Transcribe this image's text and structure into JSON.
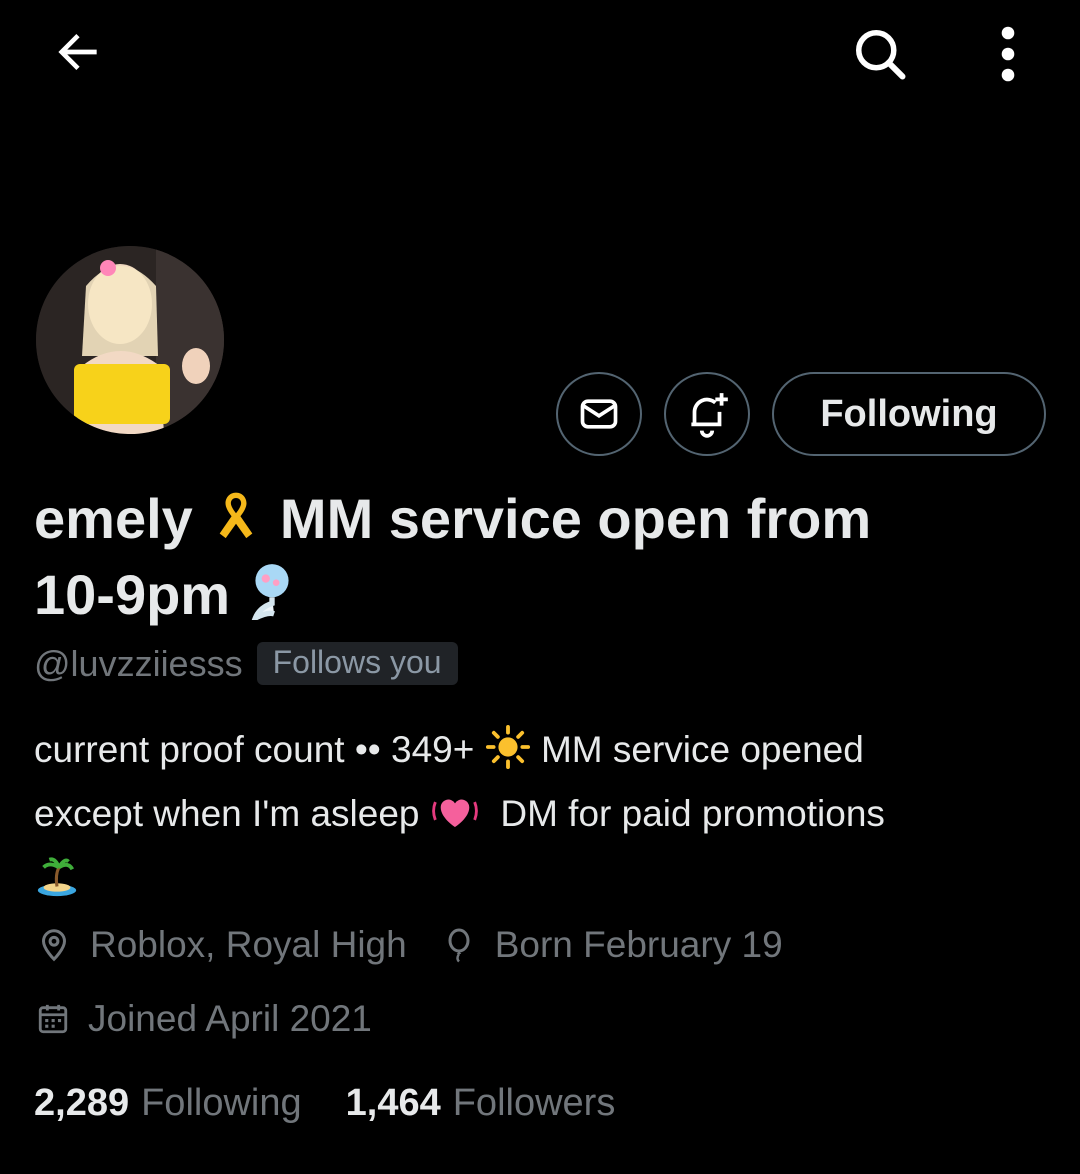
{
  "topbar": {
    "back_icon": "arrow-left-icon",
    "search_icon": "search-icon",
    "more_icon": "more-vertical-icon"
  },
  "profile": {
    "name_part1": "emely",
    "name_part2": "MM service open from",
    "name_part3": "10-9pm",
    "handle": "@luvzziiesss",
    "follows_you": "Follows you",
    "bio_line1_a": "current proof count •• 349+",
    "bio_line1_b": "MM service opened",
    "bio_line2_a": "except when I'm asleep",
    "bio_line2_b": "DM for paid promotions",
    "location": "Roblox, Royal High",
    "birthday": "Born February 19",
    "joined": "Joined April 2021"
  },
  "actions": {
    "message_icon": "envelope-icon",
    "notify_icon": "bell-plus-icon",
    "follow_label": "Following"
  },
  "stats": {
    "following_count": "2,289",
    "following_label": "Following",
    "followers_count": "1,464",
    "followers_label": "Followers"
  },
  "colors": {
    "background": "#000000",
    "primary_text": "#e7e9ea",
    "secondary_text": "#71767b",
    "border": "#536471"
  }
}
